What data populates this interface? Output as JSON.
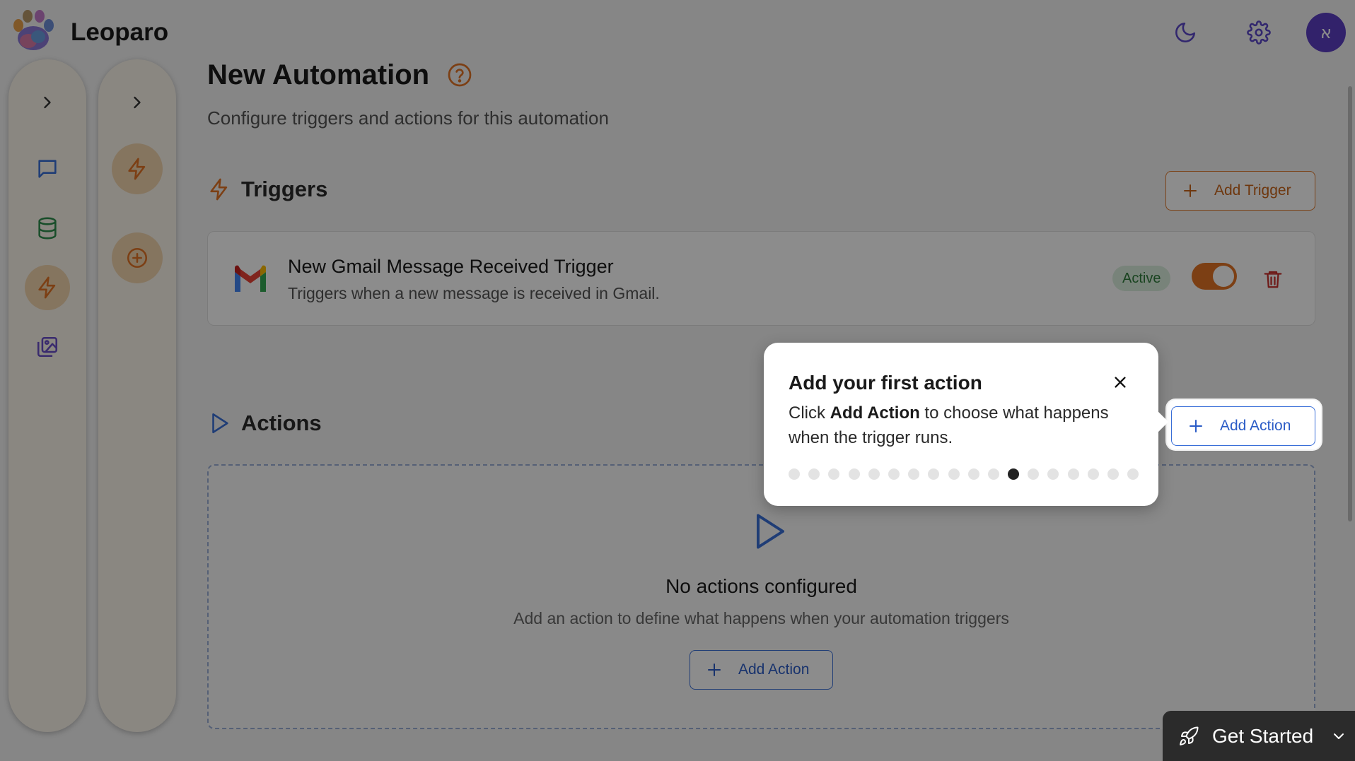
{
  "app": {
    "brand_name": "Leoparo",
    "avatar_initial": "א"
  },
  "header": {
    "icons": [
      "moon-icon",
      "gear-icon"
    ]
  },
  "sidebar_primary": {
    "items": [
      {
        "icon": "chevron-right-icon"
      },
      {
        "icon": "chat-icon"
      },
      {
        "icon": "database-icon"
      },
      {
        "icon": "lightning-icon",
        "active": true
      },
      {
        "icon": "gallery-icon"
      }
    ]
  },
  "sidebar_secondary": {
    "items": [
      {
        "icon": "chevron-right-icon"
      },
      {
        "icon": "lightning-icon",
        "active": true
      },
      {
        "icon": "plus-circle-icon",
        "active": true
      }
    ]
  },
  "page": {
    "title": "New Automation",
    "subtitle": "Configure triggers and actions for this automation"
  },
  "triggers": {
    "heading": "Triggers",
    "add_button": "Add Trigger",
    "items": [
      {
        "title": "New Gmail Message Received Trigger",
        "description": "Triggers when a new message is received in Gmail.",
        "status": "Active",
        "enabled": true
      }
    ]
  },
  "actions": {
    "heading": "Actions",
    "add_button": "Add Action",
    "empty_title": "No actions configured",
    "empty_description": "Add an action to define what happens when your automation triggers",
    "empty_button": "Add Action"
  },
  "tour": {
    "title": "Add your first action",
    "body_prefix": "Click ",
    "body_bold": "Add Action",
    "body_suffix": " to choose what happens when the trigger runs.",
    "total_steps": 18,
    "current_step": 11
  },
  "get_started": {
    "label": "Get Started"
  },
  "colors": {
    "brand_orange": "#e27425",
    "action_blue": "#2a5bc6",
    "avatar_purple": "#5b3fc4",
    "active_green": "#2f7c3b"
  }
}
